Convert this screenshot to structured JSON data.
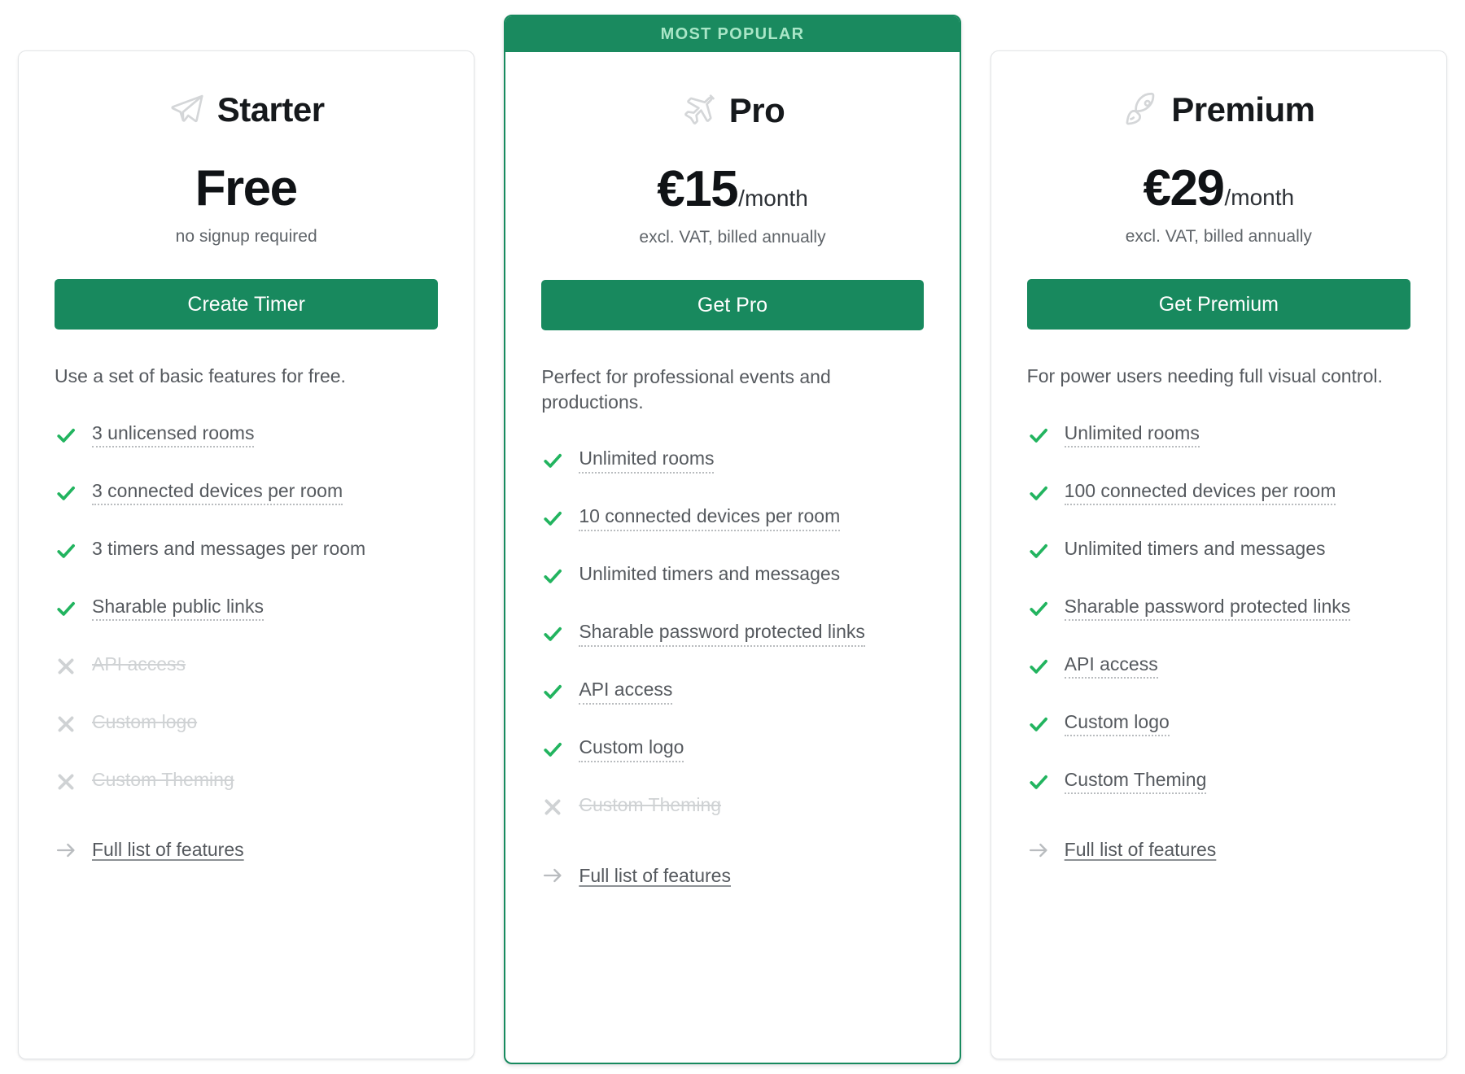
{
  "plans": [
    {
      "id": "starter",
      "icon_name": "paper-plane-icon",
      "name": "Starter",
      "featured": false,
      "badge": "",
      "price_amount": "Free",
      "price_period": "",
      "price_note": "no signup required",
      "cta_label": "Create Timer",
      "description": "Use a set of basic features for free.",
      "features": [
        {
          "label": "3 unlicensed rooms",
          "included": true,
          "hinted": true
        },
        {
          "label": "3 connected devices per room",
          "included": true,
          "hinted": true
        },
        {
          "label": "3 timers and messages per room",
          "included": true,
          "hinted": false
        },
        {
          "label": "Sharable public links",
          "included": true,
          "hinted": true
        },
        {
          "label": "API access",
          "included": false,
          "hinted": false
        },
        {
          "label": "Custom logo",
          "included": false,
          "hinted": false
        },
        {
          "label": "Custom Theming",
          "included": false,
          "hinted": false
        }
      ],
      "footer_link": "Full list of features"
    },
    {
      "id": "pro",
      "icon_name": "airplane-icon",
      "name": "Pro",
      "featured": true,
      "badge": "MOST POPULAR",
      "price_amount": "€15",
      "price_period": "/month",
      "price_note": "excl. VAT, billed annually",
      "cta_label": "Get Pro",
      "description": "Perfect for professional events and productions.",
      "features": [
        {
          "label": "Unlimited rooms",
          "included": true,
          "hinted": true
        },
        {
          "label": "10 connected devices per room",
          "included": true,
          "hinted": true
        },
        {
          "label": "Unlimited timers and messages",
          "included": true,
          "hinted": false
        },
        {
          "label": "Sharable password protected links",
          "included": true,
          "hinted": true
        },
        {
          "label": "API access",
          "included": true,
          "hinted": true
        },
        {
          "label": "Custom logo",
          "included": true,
          "hinted": true
        },
        {
          "label": "Custom Theming",
          "included": false,
          "hinted": false
        }
      ],
      "footer_link": "Full list of features"
    },
    {
      "id": "premium",
      "icon_name": "rocket-icon",
      "name": "Premium",
      "featured": false,
      "badge": "",
      "price_amount": "€29",
      "price_period": "/month",
      "price_note": "excl. VAT, billed annually",
      "cta_label": "Get Premium",
      "description": "For power users needing full visual control.",
      "features": [
        {
          "label": "Unlimited rooms",
          "included": true,
          "hinted": true
        },
        {
          "label": "100 connected devices per room",
          "included": true,
          "hinted": true
        },
        {
          "label": "Unlimited timers and messages",
          "included": true,
          "hinted": false
        },
        {
          "label": "Sharable password protected links",
          "included": true,
          "hinted": true
        },
        {
          "label": "API access",
          "included": true,
          "hinted": true
        },
        {
          "label": "Custom logo",
          "included": true,
          "hinted": true
        },
        {
          "label": "Custom Theming",
          "included": true,
          "hinted": true
        }
      ],
      "footer_link": "Full list of features"
    }
  ],
  "colors": {
    "brand_green": "#18895e",
    "badge_background": "#1a8a5f",
    "badge_text": "#a9e6c7",
    "check_green": "#22b45f",
    "cross_gray": "#cfd2d4",
    "text_body": "#55595e",
    "text_heading": "#16191c",
    "card_border": "#e3e5e7",
    "featured_border": "#178a5e"
  }
}
